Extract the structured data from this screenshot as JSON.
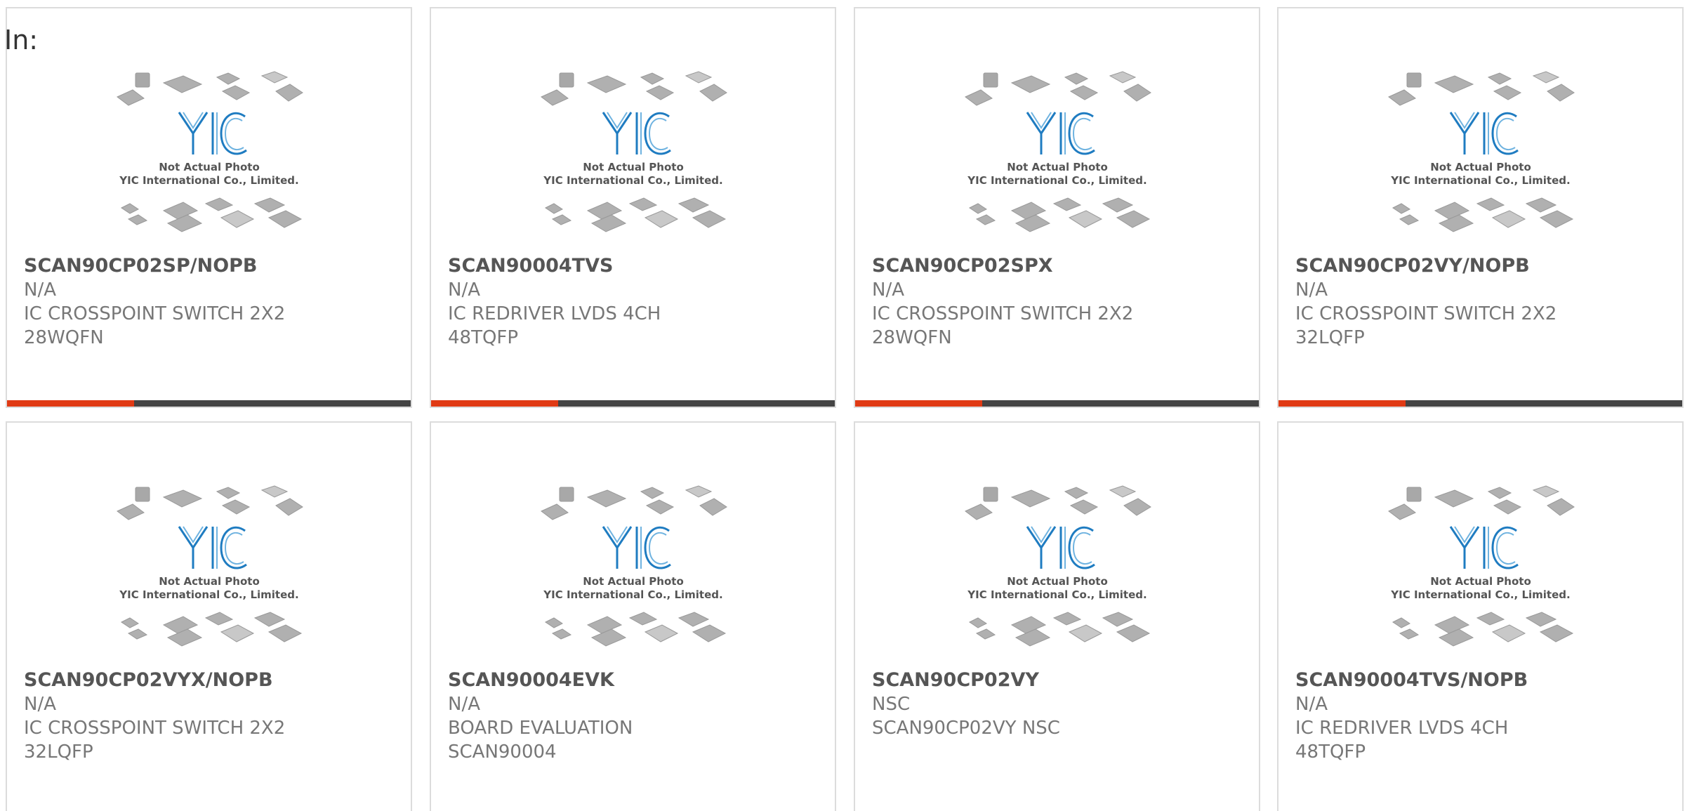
{
  "header": {
    "label": "In:"
  },
  "colors": {
    "accent": "#e03a14",
    "bar": "#444444"
  },
  "placeholder_image": {
    "line1": "Not Actual Photo",
    "line2": "YIC International Co., Limited.",
    "logo_text": "YIC"
  },
  "products": [
    {
      "part": "SCAN90CP02SP/NOPB",
      "mfr": "N/A",
      "desc": "IC CROSSPOINT SWITCH 2X2 28WQFN",
      "accent_bar": true
    },
    {
      "part": "SCAN90004TVS",
      "mfr": "N/A",
      "desc": "IC REDRIVER LVDS 4CH 48TQFP",
      "accent_bar": true
    },
    {
      "part": "SCAN90CP02SPX",
      "mfr": "N/A",
      "desc": "IC CROSSPOINT SWITCH 2X2 28WQFN",
      "accent_bar": true
    },
    {
      "part": "SCAN90CP02VY/NOPB",
      "mfr": "N/A",
      "desc": "IC CROSSPOINT SWITCH 2X2 32LQFP",
      "accent_bar": true
    },
    {
      "part": "SCAN90CP02VYX/NOPB",
      "mfr": "N/A",
      "desc": "IC CROSSPOINT SWITCH 2X2 32LQFP",
      "accent_bar": false
    },
    {
      "part": "SCAN90004EVK",
      "mfr": "N/A",
      "desc": "BOARD EVALUATION SCAN90004",
      "accent_bar": false
    },
    {
      "part": "SCAN90CP02VY",
      "mfr": "NSC",
      "desc": "SCAN90CP02VY NSC",
      "accent_bar": false
    },
    {
      "part": "SCAN90004TVS/NOPB",
      "mfr": "N/A",
      "desc": "IC REDRIVER LVDS 4CH 48TQFP",
      "accent_bar": false
    }
  ]
}
